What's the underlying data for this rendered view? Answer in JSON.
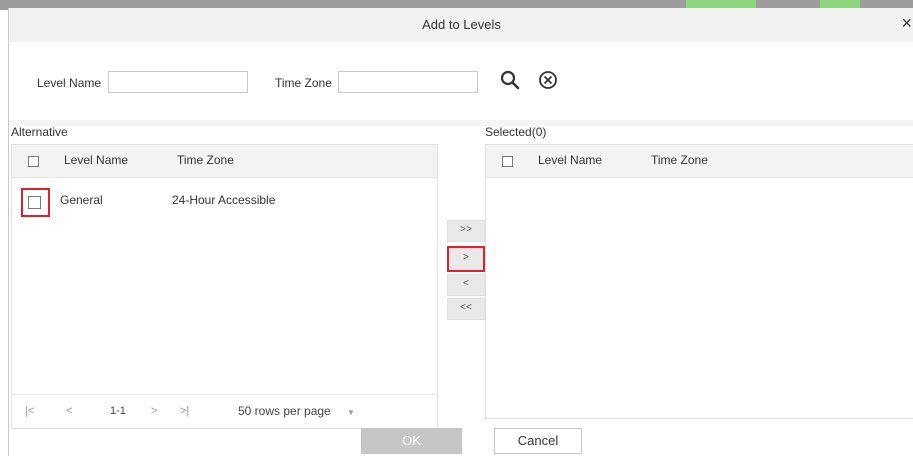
{
  "dialog": {
    "title": "Add to Levels",
    "close_glyph": "×"
  },
  "search": {
    "level_name_label": "Level Name",
    "level_name_value": "",
    "time_zone_label": "Time Zone",
    "time_zone_value": "",
    "search_icon": "search-icon",
    "clear_icon": "clear-circle-icon"
  },
  "alternative": {
    "label": "Alternative",
    "columns": [
      "Level Name",
      "Time Zone"
    ],
    "rows": [
      {
        "level_name": "General",
        "time_zone": "24-Hour Accessible"
      }
    ],
    "pager": {
      "first": "|<",
      "prev": "<",
      "range": "1-1",
      "next": ">",
      "last": ">|",
      "rows_per_page": "50 rows per page",
      "dropdown": "▼"
    }
  },
  "selected": {
    "label": "Selected(0)",
    "columns": [
      "Level Name",
      "Time Zone"
    ]
  },
  "transfer": {
    "move_all_right": ">>",
    "move_right": ">",
    "move_left": "<",
    "move_all_left": "<<"
  },
  "footer": {
    "ok_label": "OK",
    "cancel_label": "Cancel"
  },
  "colors": {
    "highlight": "#e0202a",
    "ok_disabled": "#c6c6c6"
  }
}
